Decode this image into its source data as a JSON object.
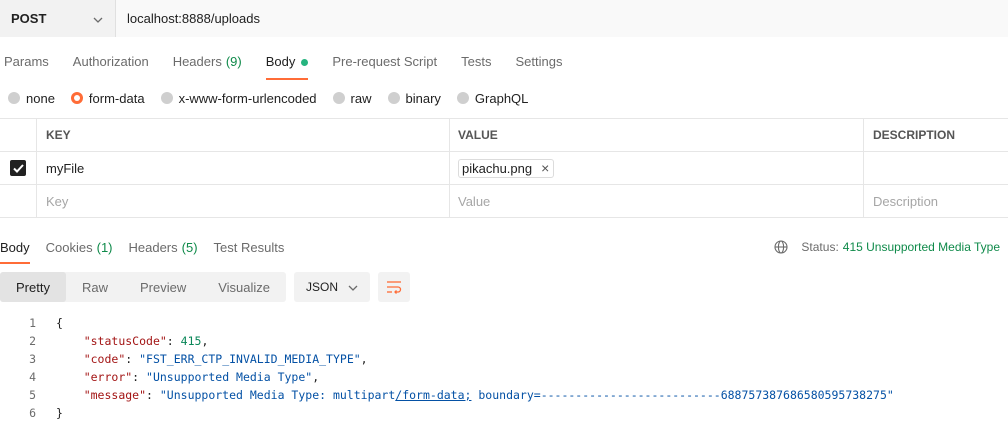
{
  "request": {
    "method": "POST",
    "url": "localhost:8888/uploads"
  },
  "request_tabs": [
    {
      "label": "Params"
    },
    {
      "label": "Authorization"
    },
    {
      "label": "Headers",
      "count": "(9)"
    },
    {
      "label": "Body",
      "active": true
    },
    {
      "label": "Pre-request Script"
    },
    {
      "label": "Tests"
    },
    {
      "label": "Settings"
    }
  ],
  "body_types": [
    {
      "label": "none"
    },
    {
      "label": "form-data",
      "checked": true
    },
    {
      "label": "x-www-form-urlencoded"
    },
    {
      "label": "raw"
    },
    {
      "label": "binary"
    },
    {
      "label": "GraphQL"
    }
  ],
  "form_table": {
    "headers": {
      "key": "KEY",
      "value": "VALUE",
      "description": "DESCRIPTION"
    },
    "row": {
      "checked": true,
      "key": "myFile",
      "file": "pikachu.png"
    },
    "new_row": {
      "key_placeholder": "Key",
      "value_placeholder": "Value",
      "description_placeholder": "Description"
    }
  },
  "response_tabs": [
    {
      "label": "Body",
      "active": true
    },
    {
      "label": "Cookies",
      "count": "(1)"
    },
    {
      "label": "Headers",
      "count": "(5)"
    },
    {
      "label": "Test Results"
    }
  ],
  "status": {
    "label": "Status:",
    "value": "415 Unsupported Media Type"
  },
  "view_modes": [
    "Pretty",
    "Raw",
    "Preview",
    "Visualize"
  ],
  "format": "JSON",
  "response_body": {
    "line_numbers": [
      "1",
      "2",
      "3",
      "4",
      "5",
      "6"
    ],
    "open_brace": "{",
    "close_brace": "}",
    "statusCode_key": "\"statusCode\"",
    "statusCode_val": "415",
    "code_key": "\"code\"",
    "code_val": "\"FST_ERR_CTP_INVALID_MEDIA_TYPE\"",
    "error_key": "\"error\"",
    "error_val": "\"Unsupported Media Type\"",
    "message_key": "\"message\"",
    "message_val_pre": "\"Unsupported Media Type: multipart",
    "message_val_link": "/form-data;",
    "message_val_post": " boundary=--------------------------688757387686580595738275\""
  },
  "colors": {
    "accent": "#ff6c37",
    "status_green": "#0f8a4a",
    "dot_green": "#26b47f"
  }
}
